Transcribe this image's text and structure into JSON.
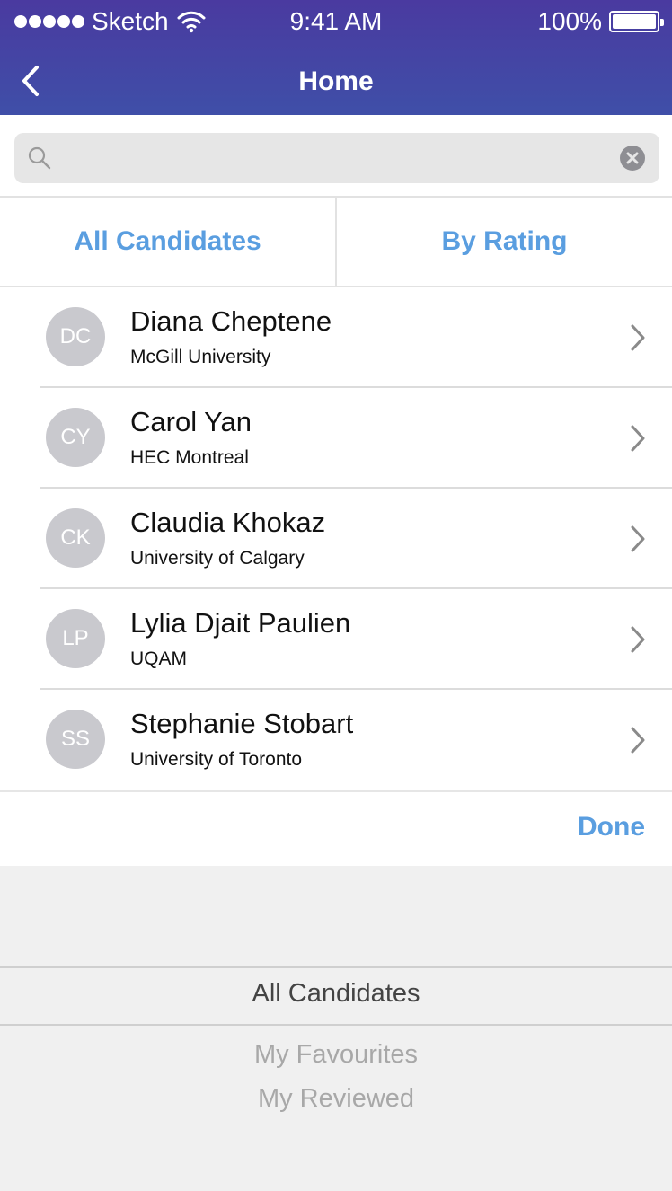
{
  "status_bar": {
    "carrier": "Sketch",
    "time": "9:41 AM",
    "battery": "100%"
  },
  "nav": {
    "title": "Home"
  },
  "search": {
    "placeholder": "",
    "value": ""
  },
  "segments": [
    {
      "label": "All Candidates"
    },
    {
      "label": "By Rating"
    }
  ],
  "candidates": [
    {
      "initials": "DC",
      "name": "Diana Cheptene",
      "school": "McGill University"
    },
    {
      "initials": "CY",
      "name": "Carol Yan",
      "school": "HEC Montreal"
    },
    {
      "initials": "CK",
      "name": "Claudia Khokaz",
      "school": "University of Calgary"
    },
    {
      "initials": "LP",
      "name": "Lylia Djait Paulien",
      "school": "UQAM"
    },
    {
      "initials": "SS",
      "name": "Stephanie Stobart",
      "school": "University of Toronto"
    }
  ],
  "done_label": "Done",
  "picker": {
    "selected": "All Candidates",
    "options": [
      "My Favourites",
      "My Reviewed"
    ]
  },
  "colors": {
    "header_top": "#4a3aa0",
    "header_bottom": "#3f4fa8",
    "accent": "#5a9ee0",
    "avatar": "#c9c9ce"
  }
}
